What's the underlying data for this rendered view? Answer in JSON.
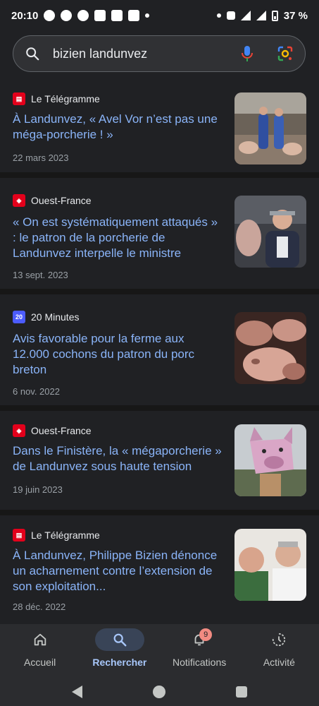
{
  "status_bar": {
    "time": "20:10",
    "battery": "37 %"
  },
  "search": {
    "query": "bizien landunvez",
    "icons": [
      "search-icon",
      "mic-icon",
      "lens-icon"
    ]
  },
  "articles": [
    {
      "source": "Le Télégramme",
      "logo_color": "#e3001b",
      "title": "À Landunvez, « Avel Vor n’est pas une méga-porcherie ! »",
      "date": "22 mars 2023",
      "image_alt": "two men standing in a pig barn"
    },
    {
      "source": "Ouest-France",
      "logo_color": "#e3001b",
      "title": "« On est systématiquement attaqués » : le patron de la porcherie de Landunvez interpelle le ministre",
      "date": "13 sept. 2023",
      "image_alt": "man in suit gesturing"
    },
    {
      "source": "20 Minutes",
      "logo_color": "#4c5cff",
      "title": "Avis favorable pour la ferme aux 12.000 cochons du patron du porc breton",
      "date": "6 nov. 2022",
      "image_alt": "pigs close-up"
    },
    {
      "source": "Ouest-France",
      "logo_color": "#e3001b",
      "title": "Dans le Finistère, la « mégaporcherie » de Landunvez sous haute tension",
      "date": "19 juin 2023",
      "image_alt": "person wearing a paper pig mask"
    },
    {
      "source": "Le Télégramme",
      "logo_color": "#e3001b",
      "title": "À Landunvez, Philippe Bizien dénonce un acharnement contre l’extension de son exploitation...",
      "date": "28 déc. 2022",
      "image_alt": "two smiling men"
    }
  ],
  "bottom_nav": {
    "items": [
      {
        "label": "Accueil",
        "icon": "home-icon"
      },
      {
        "label": "Rechercher",
        "icon": "search-icon",
        "active": true
      },
      {
        "label": "Notifications",
        "icon": "bell-icon",
        "badge": "9"
      },
      {
        "label": "Activité",
        "icon": "activity-icon"
      }
    ]
  },
  "colors": {
    "background": "#202124",
    "link": "#8ab4f8",
    "active_nav": "#a8c7fa"
  }
}
